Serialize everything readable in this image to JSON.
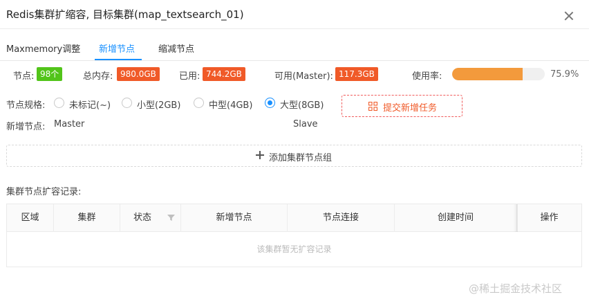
{
  "modal": {
    "title": "Redis集群扩缩容, 目标集群(map_textsearch_01)"
  },
  "tabs": [
    {
      "label": "Maxmemory调整",
      "active": false
    },
    {
      "label": "新增节点",
      "active": true
    },
    {
      "label": "缩减节点",
      "active": false
    }
  ],
  "stats": {
    "nodes_label": "节点:",
    "nodes_value": "98个",
    "total_memory_label": "总内存:",
    "total_memory_value": "980.0GB",
    "used_label": "已用:",
    "used_value": "744.2GB",
    "available_label": "可用(Master):",
    "available_value": "117.3GB",
    "usage_label": "使用率:",
    "usage_percent": 75.9,
    "usage_text": "75.9%"
  },
  "spec": {
    "label": "节点规格:",
    "options": [
      {
        "label": "未标记(~)",
        "checked": false
      },
      {
        "label": "小型(2GB)",
        "checked": false
      },
      {
        "label": "中型(4GB)",
        "checked": false
      },
      {
        "label": "大型(8GB)",
        "checked": true
      }
    ],
    "submit_label": "提交新增任务"
  },
  "new_nodes": {
    "label": "新增节点:",
    "master": "Master",
    "slave": "Slave"
  },
  "add_group_label": "添加集群节点组",
  "history": {
    "title": "集群节点扩容记录:",
    "columns": [
      "区域",
      "集群",
      "状态",
      "新增节点",
      "节点连接",
      "创建时间",
      "操作"
    ],
    "empty_text": "该集群暂无扩容记录"
  },
  "watermark": "@稀土掘金技术社区",
  "colors": {
    "accent": "#1890ff",
    "badge_green": "#52c41a",
    "badge_red": "#f05a28",
    "progress": "#f39a3c"
  }
}
